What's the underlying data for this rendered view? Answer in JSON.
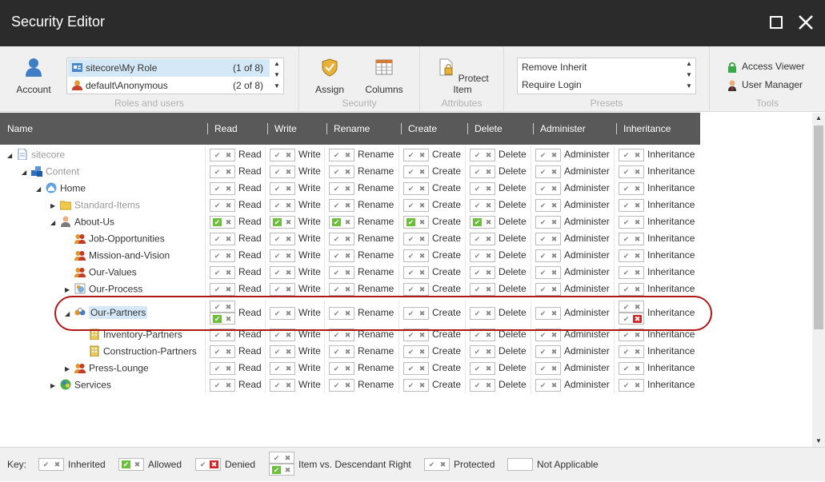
{
  "window": {
    "title": "Security Editor"
  },
  "ribbon": {
    "account_label": "Account",
    "roles": [
      {
        "name": "sitecore\\My Role",
        "count": "(1 of 8)"
      },
      {
        "name": "default\\Anonymous",
        "count": "(2 of 8)"
      }
    ],
    "roles_group_label": "Roles and users",
    "assign_label": "Assign",
    "columns_label": "Columns",
    "security_group_label": "Security",
    "protect_item_label": "Protect Item",
    "attributes_group_label": "Attributes",
    "presets": [
      "Remove Inherit",
      "Require Login"
    ],
    "presets_group_label": "Presets",
    "access_viewer_label": "Access Viewer",
    "user_manager_label": "User Manager",
    "tools_group_label": "Tools"
  },
  "grid": {
    "headers": [
      "Name",
      "Read",
      "Write",
      "Rename",
      "Create",
      "Delete",
      "Administer",
      "Inheritance"
    ],
    "rows": [
      {
        "name": "sitecore",
        "level": 0,
        "expander": "open",
        "icon": "page-icon",
        "grey": true
      },
      {
        "name": "Content",
        "level": 1,
        "expander": "open",
        "icon": "content-icon",
        "grey": true
      },
      {
        "name": "Home",
        "level": 2,
        "expander": "open",
        "icon": "home-icon",
        "grey": false
      },
      {
        "name": "Standard-Items",
        "level": 3,
        "expander": "closed",
        "icon": "folder-icon",
        "grey": true
      },
      {
        "name": "About-Us",
        "level": 3,
        "expander": "open",
        "icon": "person-icon",
        "grey": false,
        "allowed": true
      },
      {
        "name": "Job-Opportunities",
        "level": 4,
        "expander": "none",
        "icon": "group-icon",
        "grey": false
      },
      {
        "name": "Mission-and-Vision",
        "level": 4,
        "expander": "none",
        "icon": "group-icon",
        "grey": false
      },
      {
        "name": "Our-Values",
        "level": 4,
        "expander": "none",
        "icon": "group-icon",
        "grey": false
      },
      {
        "name": "Our-Process",
        "level": 4,
        "expander": "closed",
        "icon": "process-icon",
        "grey": false
      },
      {
        "name": "Our-Partners",
        "level": 4,
        "expander": "open",
        "icon": "partners-icon",
        "grey": false,
        "selected": true
      },
      {
        "name": "Inventory-Partners",
        "level": 5,
        "expander": "none",
        "icon": "building-icon",
        "grey": false
      },
      {
        "name": "Construction-Partners",
        "level": 5,
        "expander": "none",
        "icon": "building-icon",
        "grey": false
      },
      {
        "name": "Press-Lounge",
        "level": 4,
        "expander": "closed",
        "icon": "group-icon",
        "grey": false
      },
      {
        "name": "Services",
        "level": 3,
        "expander": "closed",
        "icon": "services-icon",
        "grey": false
      }
    ]
  },
  "key": {
    "label": "Key:",
    "items": [
      "Inherited",
      "Allowed",
      "Denied",
      "Item vs. Descendant Right",
      "Protected",
      "Not Applicable"
    ]
  },
  "colors": {
    "titlebar": "#2b2b2b",
    "header": "#595959",
    "allowed": "#6bbf3b",
    "denied": "#d42525",
    "highlight": "#b01818",
    "selection": "#d5e8f7"
  }
}
